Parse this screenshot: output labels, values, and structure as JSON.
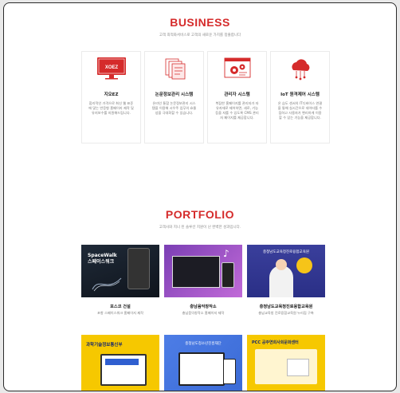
{
  "business": {
    "title": "BUSINESS",
    "subtitle": "고객 최적화서비스로 고객의 새로운 가치를 창출합니다",
    "cards": [
      {
        "icon": "xoez-monitor-icon",
        "logo": "XOEZ",
        "title": "지오EZ",
        "desc": "합리적인 가격으로 최신 웹 표준에 맞는 반응형 홈페이지 제작 및 유지보수를 지원해드립니다."
      },
      {
        "icon": "document-stack-icon",
        "title": "논문정보관리 시스템",
        "desc": "온라인 통합 논문정보관리 시스템을 이용해 시우주 업무의 효율성을 극대화할 수 있습니다."
      },
      {
        "icon": "gear-window-icon",
        "title": "관리자 시스템",
        "desc": "복잡한 홈페이지를 관리자가 자유자재로 제어하면, 새로, 기능 등을 자를 수 있도록 CMS 관리자 페이지를 제공합니다."
      },
      {
        "icon": "cloud-iot-icon",
        "title": "IoT 원격제어 시스템",
        "desc": "온 습도 센서의 IT디바이스 연결을 통해 실시간으로 데이터를 수집하고 사용자가 편리하게 이용할 수 있는 기능을 제공합니다."
      }
    ]
  },
  "portfolio": {
    "title": "PORTFOLIO",
    "subtitle": "고객사와 지니 된 솔루션 지원이 난 완벽한 성과입니다.",
    "items": [
      {
        "title": "포스코 건설",
        "desc": "포항 스페이스워크 홈페이지 제작",
        "thumb_text": "SpaceWalk 스페이스워크"
      },
      {
        "title": "충남음악창작소",
        "desc": "충남음악창작소 홈페이지 제작",
        "thumb_text": ""
      },
      {
        "title": "충청남도교육청진로융합교육원",
        "desc": "충남교육청 진로융합교육원 누리집 구축",
        "thumb_text": "충청남도교육청진로융합교육원"
      },
      {
        "title": "",
        "desc": "",
        "thumb_text": "과학기술정보통신부"
      },
      {
        "title": "",
        "desc": "",
        "thumb_text": "충청남도청소년진흥재단"
      },
      {
        "title": "",
        "desc": "",
        "thumb_text": "PCC 공주연희사회문화센터"
      }
    ]
  },
  "colors": {
    "accent": "#d52b2b",
    "text": "#222222",
    "muted": "#777777"
  }
}
